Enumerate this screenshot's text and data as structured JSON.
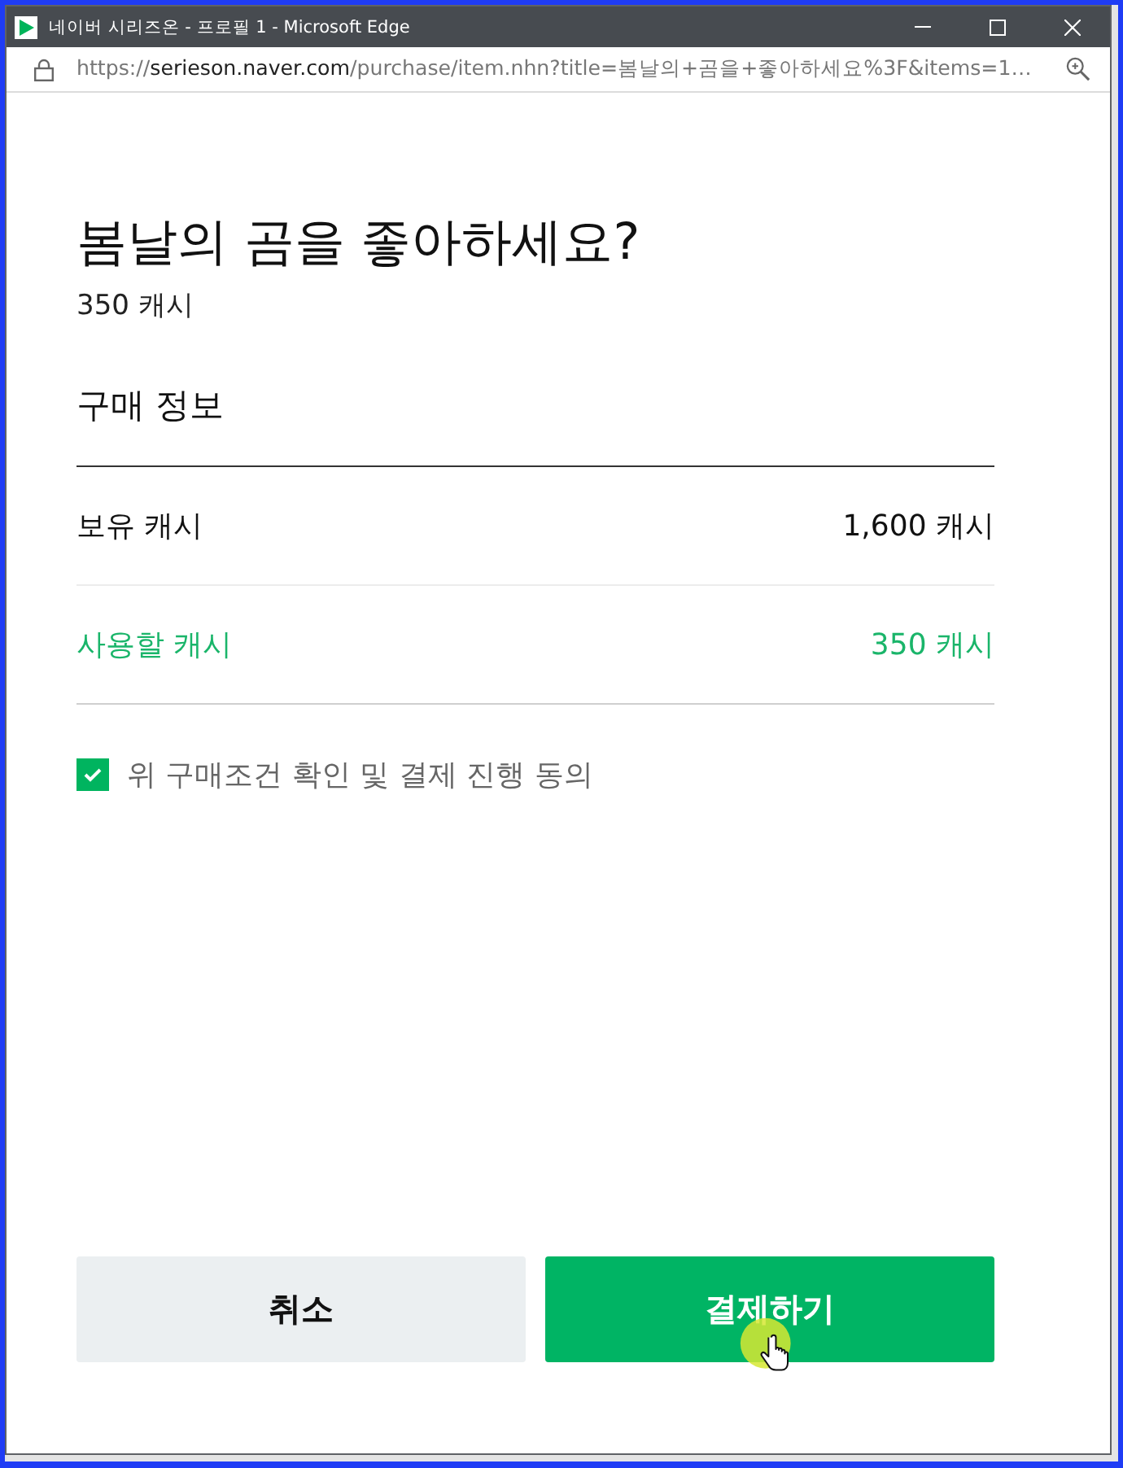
{
  "window": {
    "title": "네이버 시리즈온 - 프로필 1 - Microsoft Edge",
    "address": {
      "scheme": "https://",
      "host": "serieson.naver.com",
      "path": "/purchase/item.nhn?title=봄날의+곰을+좋아하세요%3F&items=1…"
    }
  },
  "purchase": {
    "title": "봄날의 곰을 좋아하세요?",
    "price": "350 캐시",
    "section_title": "구매 정보",
    "rows": [
      {
        "label": "보유 캐시",
        "value": "1,600 캐시",
        "kind": "plain"
      },
      {
        "label": "사용할 캐시",
        "value": "350 캐시",
        "kind": "highlight"
      }
    ],
    "agreement": {
      "label": "위 구매조건 확인 및 결제 진행 동의",
      "checked": true
    }
  },
  "buttons": [
    {
      "label": "취소",
      "kind": "secondary"
    },
    {
      "label": "결제하기",
      "kind": "primary"
    }
  ]
}
